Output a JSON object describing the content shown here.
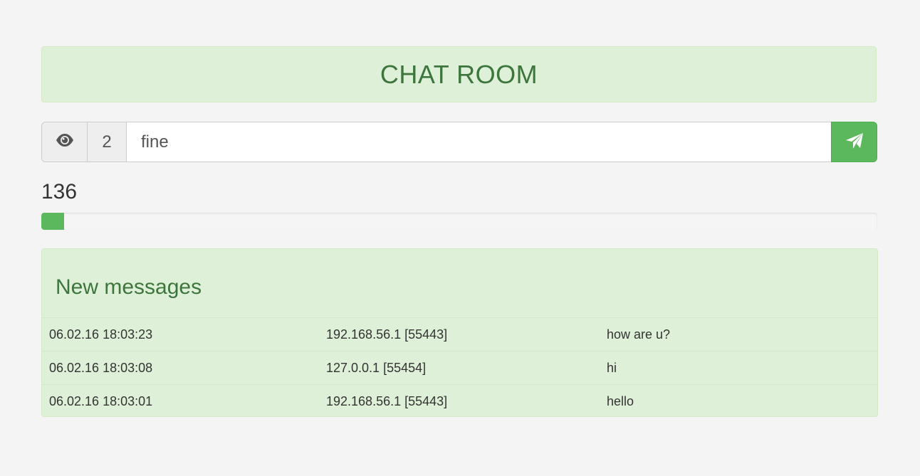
{
  "title": "CHAT ROOM",
  "input_bar": {
    "viewers_icon": "eye-icon",
    "viewers_count": "2",
    "message_value": "fine",
    "send_icon": "paper-plane-icon"
  },
  "counter": {
    "value": "136",
    "progress_fraction": 0.027
  },
  "messages": {
    "heading": "New messages",
    "rows": [
      {
        "time": "06.02.16 18:03:23",
        "address": "192.168.56.1 [55443]",
        "text": "how are u?"
      },
      {
        "time": "06.02.16 18:03:08",
        "address": "127.0.0.1 [55454]",
        "text": "hi"
      },
      {
        "time": "06.02.16 18:03:01",
        "address": "192.168.56.1 [55443]",
        "text": "hello"
      }
    ]
  },
  "colors": {
    "accent": "#5cb85c",
    "panel_bg": "#dff0d8",
    "panel_text": "#3c763d",
    "page_bg": "#f4f4f4"
  }
}
